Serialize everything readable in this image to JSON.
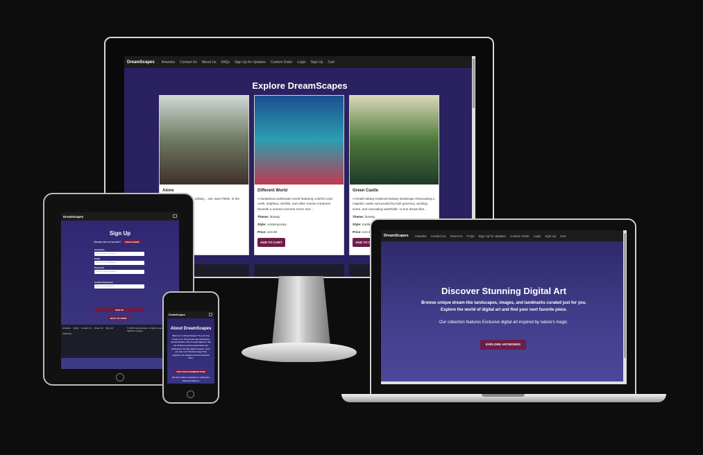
{
  "brand": "DreamScapes",
  "nav_links": [
    "Artworks",
    "Contact Us",
    "About Us",
    "FAQs",
    "Sign Up for Updates",
    "Custom Order",
    "Login",
    "Sign Up",
    "Cart"
  ],
  "desktop": {
    "title": "Explore DreamScapes",
    "cards": [
      {
        "name": "Alone",
        "desc": "...traying the back of a solitary ...set, open fields. In the",
        "colors": [
          "#cfd8d6",
          "#6f7a63",
          "#3f2f2b"
        ]
      },
      {
        "name": "Different World",
        "desc": "A fantastical underwater world featuring colorful coral reefs, dolphins, merfish, and other marine creatures beneath a surreal crescent moon and ...",
        "theme": "fantasy",
        "style": "contemporary",
        "price": "£10.99",
        "button": "ADD TO CART",
        "colors": [
          "#1b4f8f",
          "#2c9fb0",
          "#c0394f"
        ]
      },
      {
        "name": "Green Castle",
        "desc": "A breath-taking medieval fantasy landscape showcasing a majestic castle surrounded by lush greenery, winding rivers, and cascading waterfalls—a true dream-like...",
        "theme": "fantasy",
        "style": "traditional",
        "price": "£10.99",
        "button": "ADD TO CART",
        "colors": [
          "#d9d8b8",
          "#4e7a3b",
          "#1f3a2a"
        ]
      }
    ],
    "labels": {
      "theme": "Theme:",
      "style": "Style:",
      "price": "Price:"
    }
  },
  "tablet": {
    "title": "Sign Up",
    "have_account": "Already have an account?",
    "signin_button": "SIGN IN HERE",
    "fields": [
      {
        "label": "Username",
        "placeholder": "Enter a unique username"
      },
      {
        "label": "Email",
        "placeholder": "Enter your email address"
      },
      {
        "label": "Password",
        "placeholder": "Create a strong password"
      },
      {
        "label": "Confirm Password",
        "placeholder": "Repeat your password"
      }
    ],
    "signup_button": "SIGN UP",
    "back_button": "BACK TO HOME",
    "footer_links": [
      "Artworks",
      "FAQs",
      "Contact Us",
      "About Us",
      "Sign Up",
      "Facebook"
    ],
    "footer_copy": "© 2024 DreamScapes. All rights reserved. Exclusive digital art Images"
  },
  "phone": {
    "title": "About DreamScapes",
    "text": "Welcome to DreamScapes! The art shop mission is to bring dream-like landscapes and landmarks to life through digital art. We are all about exploring landmarks and landscapes through digital creativity. Have you seen our Facebook page? We regularly post updates and new artworks there.",
    "button": "VISIT OUR FACEBOOK PAGE",
    "text2": "We find endless inspiration in visiting the National Gallery in"
  },
  "laptop": {
    "title": "Discover Stunning Digital Art",
    "sub1": "Browse unique dream-like landscapes, images, and landmarks curated just for you.",
    "sub2": "Explore the world of digital art and find your next favorite piece.",
    "sub3": "Our collection features Exclusive digital art inspired by nature's magic.",
    "button": "EXPLORE ARTWORKS"
  }
}
